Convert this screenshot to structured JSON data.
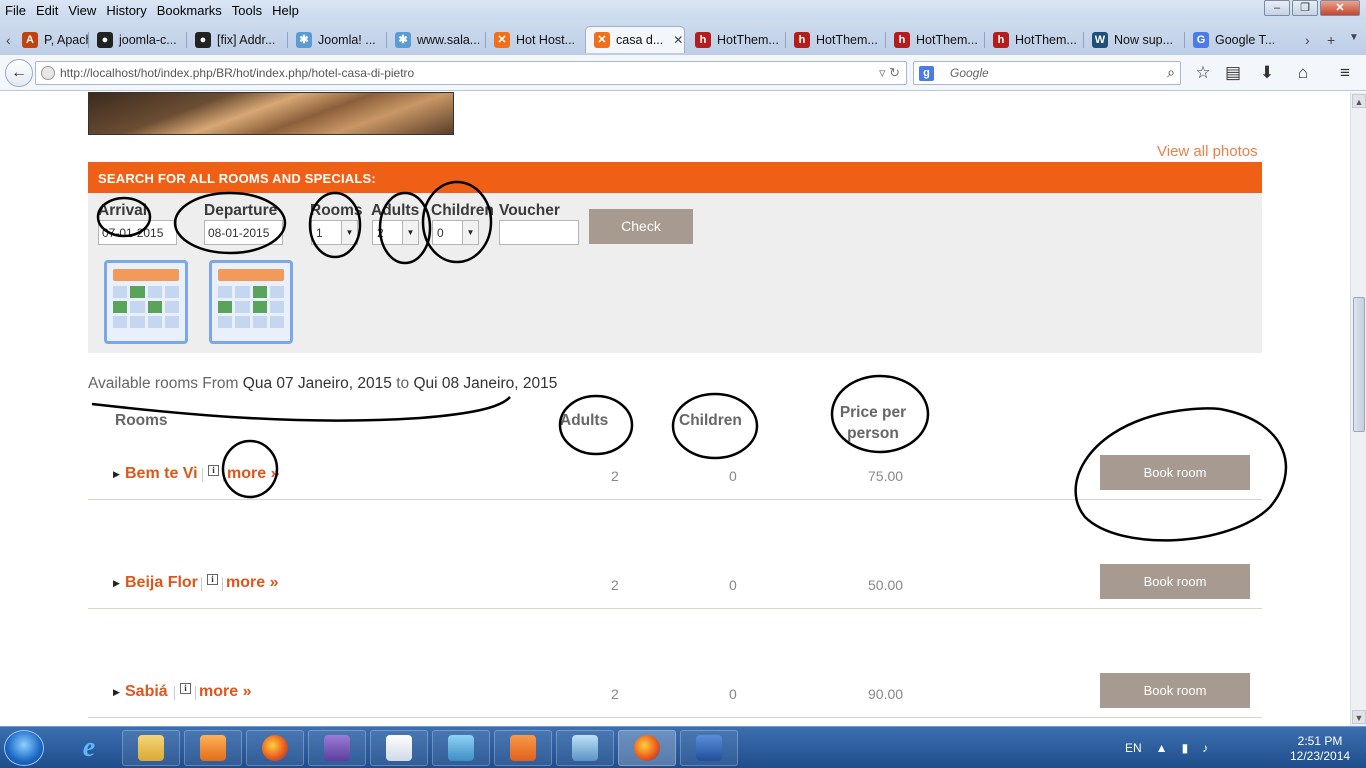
{
  "menu": [
    "File",
    "Edit",
    "View",
    "History",
    "Bookmarks",
    "Tools",
    "Help"
  ],
  "tabs": [
    {
      "label": "P, Apach...",
      "icon": "apache-icon",
      "color": "#c2410c"
    },
    {
      "label": "joomla-c...",
      "icon": "github-icon",
      "color": "#222222"
    },
    {
      "label": "[fix] Addr...",
      "icon": "github-icon",
      "color": "#222222"
    },
    {
      "label": "Joomla! ...",
      "icon": "joomla-icon",
      "color": "#5b9bd5"
    },
    {
      "label": "www.sala...",
      "icon": "joomla-icon",
      "color": "#5b9bd5"
    },
    {
      "label": "Hot Host...",
      "icon": "xampp-icon",
      "color": "#f0711b"
    },
    {
      "label": "casa d...",
      "icon": "xampp-icon",
      "color": "#f0711b",
      "active": true
    },
    {
      "label": "HotThem...",
      "icon": "hotthemes-icon",
      "color": "#b31d1d"
    },
    {
      "label": "HotThem...",
      "icon": "hotthemes-icon",
      "color": "#b31d1d"
    },
    {
      "label": "HotThem...",
      "icon": "hotthemes-icon",
      "color": "#b31d1d"
    },
    {
      "label": "HotThem...",
      "icon": "hotthemes-icon",
      "color": "#b31d1d"
    },
    {
      "label": "Now sup...",
      "icon": "wordpress-icon",
      "color": "#1f4e79"
    },
    {
      "label": "Google T...",
      "icon": "google-translate-icon",
      "color": "#4a7be8"
    }
  ],
  "nav": {
    "url": "http://localhost/hot/index.php/BR/hot/index.php/hotel-casa-di-pietro",
    "search_placeholder": "Google"
  },
  "page": {
    "view_all": "View all photos",
    "search_heading": "SEARCH FOR ALL ROOMS AND SPECIALS:",
    "form": {
      "arrival_label": "Arrival",
      "arrival_value": "07-01-2015",
      "departure_label": "Departure",
      "departure_value": "08-01-2015",
      "rooms_label": "Rooms",
      "rooms_value": "1",
      "adults_label": "Adults",
      "adults_value": "2",
      "children_label": "Children",
      "children_value": "0",
      "voucher_label": "Voucher",
      "voucher_value": "",
      "check_label": "Check"
    },
    "availability": {
      "prefix": "Available rooms From",
      "from": "Qua 07 Janeiro, 2015",
      "to_word": "to",
      "to": "Qui 08 Janeiro, 2015"
    },
    "columns": {
      "rooms": "Rooms",
      "adults": "Adults",
      "children": "Children",
      "price_line1": "Price per",
      "price_line2": "person"
    },
    "rooms": [
      {
        "name": "Bem te Vi",
        "more": "more »",
        "adults": "2",
        "children": "0",
        "price": "75.00",
        "book": "Book room"
      },
      {
        "name": "Beija Flor",
        "more": "more »",
        "adults": "2",
        "children": "0",
        "price": "50.00",
        "book": "Book room"
      },
      {
        "name": "Sabiá",
        "more": "more »",
        "adults": "2",
        "children": "0",
        "price": "90.00",
        "book": "Book room"
      }
    ]
  },
  "taskbar": {
    "lang": "EN",
    "time": "2:51 PM",
    "date": "12/23/2014"
  }
}
